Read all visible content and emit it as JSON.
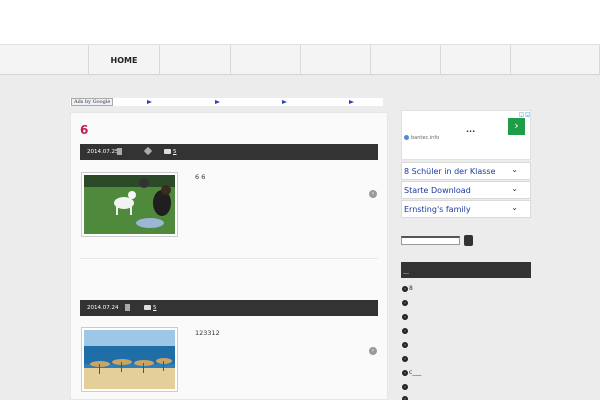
{
  "nav": {
    "items": [
      "HOME",
      "",
      "",
      "",
      "",
      "",
      "",
      ""
    ]
  },
  "ads": {
    "label": "Ads by Google"
  },
  "post1": {
    "title": "6",
    "date": "2014.07.25",
    "comments": "5",
    "excerpt": "6 6"
  },
  "post2": {
    "date": "2014.07.24",
    "comments": "5",
    "excerpt": "123312"
  },
  "sidebar": {
    "ad": {
      "headline": "...",
      "url": "bantec.info",
      "go": "›"
    },
    "links": [
      "8 Schüler in der Klasse",
      "Starte Download",
      "Ernsting's family"
    ],
    "list": [
      "8",
      "",
      "",
      "",
      "",
      "",
      "c___",
      "",
      ""
    ]
  },
  "icons": {
    "more": "›",
    "chevron": "⌄"
  }
}
